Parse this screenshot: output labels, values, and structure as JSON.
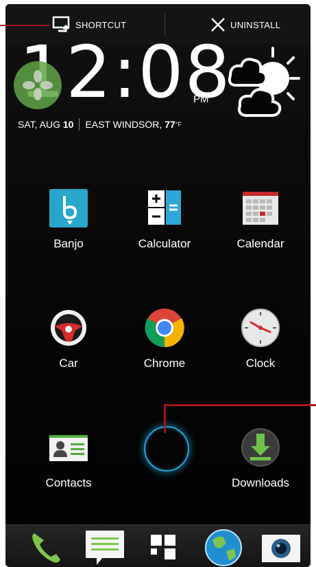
{
  "action_bar": {
    "shortcut_label": "SHORTCUT",
    "uninstall_label": "UNINSTALL"
  },
  "clock": {
    "time": "12:08",
    "ampm": "PM",
    "day": "SAT, AUG",
    "date": "10",
    "location": "EAST WINDSOR,",
    "temp": "77",
    "unit": "°F"
  },
  "apps": [
    {
      "label": "Banjo",
      "icon": "banjo-icon"
    },
    {
      "label": "Calculator",
      "icon": "calculator-icon"
    },
    {
      "label": "Calendar",
      "icon": "calendar-icon"
    },
    {
      "label": "Car",
      "icon": "car-steering-wheel-icon"
    },
    {
      "label": "Chrome",
      "icon": "chrome-icon"
    },
    {
      "label": "Clock",
      "icon": "clock-icon"
    },
    {
      "label": "Contacts",
      "icon": "contacts-icon"
    },
    {
      "label": "Downloads",
      "icon": "downloads-icon"
    }
  ],
  "dock": [
    "phone-icon",
    "messages-icon",
    "apps-grid-icon",
    "browser-globe-icon",
    "camera-icon"
  ],
  "colors": {
    "background": "#050505",
    "callout": "#a11921",
    "accent_blue": "#1fa6d9",
    "drag_green": "#5fa546"
  }
}
